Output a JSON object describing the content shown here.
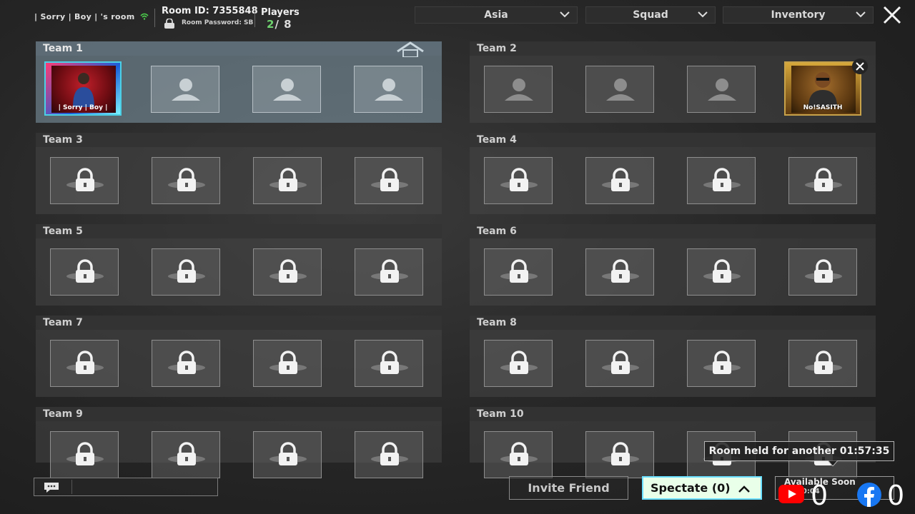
{
  "room": {
    "name": "| Sorry | Boy | 's room",
    "id_label": "Room ID: 7355848",
    "password_label": "Room Password: SB",
    "players_label": "Players",
    "players_current": "2",
    "players_total": "/ 8"
  },
  "filters": {
    "region": "Asia",
    "mode": "Squad",
    "inventory": "Inventory"
  },
  "teams": [
    {
      "label": "Team 1"
    },
    {
      "label": "Team 2"
    },
    {
      "label": "Team 3"
    },
    {
      "label": "Team 4"
    },
    {
      "label": "Team 5"
    },
    {
      "label": "Team 6"
    },
    {
      "label": "Team 7"
    },
    {
      "label": "Team 8"
    },
    {
      "label": "Team 9"
    },
    {
      "label": "Team 10"
    }
  ],
  "players": {
    "p1_name": "| Sorry | Boy |",
    "p2_name": "No!SASITH"
  },
  "bottom": {
    "invite_label": "Invite Friend",
    "spectate_label": "Spectate (0)",
    "start_label": "Available Soon",
    "start_timer": "00:00:04",
    "held_text": "Room held for another 01:57:35",
    "youtube_count": "0",
    "facebook_count": "0"
  },
  "colors": {
    "accent_green": "#6fd36f",
    "spectate_bg": "#e9ffe9",
    "spectate_border": "#6be0ff"
  }
}
